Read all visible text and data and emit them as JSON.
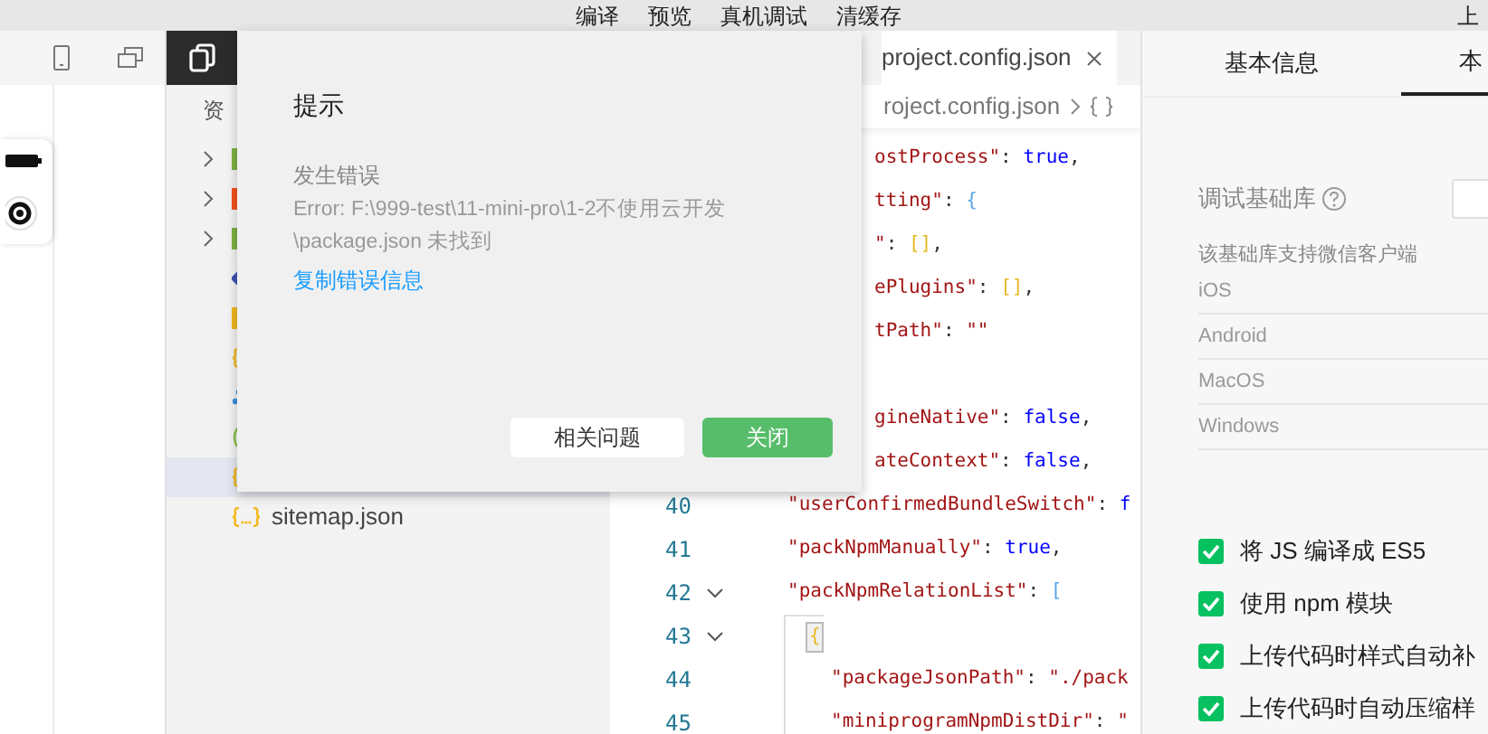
{
  "menu_bar": {
    "items": [
      "编译",
      "预览",
      "真机调试",
      "清缓存"
    ],
    "right_item": "上"
  },
  "explorer": {
    "title": "资",
    "items": [
      {
        "kind": "folder",
        "color": "#7cb342",
        "has_children": true,
        "selected": false
      },
      {
        "kind": "folder",
        "color": "#f4511e",
        "has_children": true,
        "selected": false
      },
      {
        "kind": "folder",
        "color": "#7cb342",
        "has_children": true,
        "selected": false
      },
      {
        "kind": "markup",
        "selected": false
      },
      {
        "kind": "style",
        "selected": false
      },
      {
        "kind": "json",
        "selected": false
      },
      {
        "kind": "script",
        "selected": false
      },
      {
        "kind": "config",
        "selected": false
      },
      {
        "kind": "json",
        "selected": true
      },
      {
        "kind": "json",
        "label": "sitemap.json",
        "selected": false
      }
    ]
  },
  "editor": {
    "tab": {
      "label": "project.config.json",
      "selected": true
    },
    "breadcrumb": "roject.config.json",
    "lines": [
      {
        "kind": "clipped",
        "tokens": [
          {
            "kind": "key",
            "text": "ostProcess\""
          },
          {
            "kind": "punct",
            "text": ": "
          },
          {
            "kind": "keyword",
            "text": "true"
          },
          {
            "kind": "punct",
            "text": ","
          }
        ]
      },
      {
        "kind": "clipped",
        "tokens": [
          {
            "kind": "key",
            "text": "tting\""
          },
          {
            "kind": "punct",
            "text": ": "
          },
          {
            "kind": "bracket",
            "text": "{"
          }
        ]
      },
      {
        "kind": "clipped",
        "tokens": [
          {
            "kind": "key",
            "text": "\""
          },
          {
            "kind": "punct",
            "text": ": "
          },
          {
            "kind": "bracket2",
            "text": "[]"
          },
          {
            "kind": "punct",
            "text": ","
          }
        ]
      },
      {
        "kind": "clipped",
        "tokens": [
          {
            "kind": "key",
            "text": "ePlugins\""
          },
          {
            "kind": "punct",
            "text": ": "
          },
          {
            "kind": "bracket2",
            "text": "[]"
          },
          {
            "kind": "punct",
            "text": ","
          }
        ]
      },
      {
        "kind": "clipped",
        "tokens": [
          {
            "kind": "key",
            "text": "tPath\""
          },
          {
            "kind": "punct",
            "text": ": "
          },
          {
            "kind": "key",
            "text": "\"\""
          }
        ]
      },
      {
        "kind": "clipped"
      },
      {
        "kind": "clipped",
        "tokens": [
          {
            "kind": "key",
            "text": "gineNative\""
          },
          {
            "kind": "punct",
            "text": ": "
          },
          {
            "kind": "keyword",
            "text": "false"
          },
          {
            "kind": "punct",
            "text": ","
          }
        ]
      },
      {
        "kind": "clipped",
        "tokens": [
          {
            "kind": "key",
            "text": "ateContext\""
          },
          {
            "kind": "punct",
            "text": ": "
          },
          {
            "kind": "keyword",
            "text": "false"
          },
          {
            "kind": "punct",
            "text": ","
          }
        ]
      },
      {
        "kind": "plain",
        "number": "40",
        "tokens": [
          {
            "kind": "key",
            "text": "\"userConfirmedBundleSwitch\""
          },
          {
            "kind": "punct",
            "text": ": "
          },
          {
            "kind": "keyword",
            "text": "f"
          }
        ]
      },
      {
        "kind": "plain",
        "number": "41",
        "tokens": [
          {
            "kind": "key",
            "text": "\"packNpmManually\""
          },
          {
            "kind": "punct",
            "text": ": "
          },
          {
            "kind": "keyword",
            "text": "true"
          },
          {
            "kind": "punct",
            "text": ","
          }
        ]
      },
      {
        "kind": "plain",
        "number": "42",
        "foldable": true,
        "tokens": [
          {
            "kind": "key",
            "text": "\"packNpmRelationList\""
          },
          {
            "kind": "punct",
            "text": ": "
          },
          {
            "kind": "bracket",
            "text": "["
          }
        ]
      },
      {
        "kind": "brace",
        "number": "43",
        "foldable": true,
        "tokens": [
          {
            "kind": "bracket2",
            "text": "{"
          }
        ]
      },
      {
        "kind": "nested",
        "number": "44",
        "tokens": [
          {
            "kind": "key",
            "text": "\"packageJsonPath\""
          },
          {
            "kind": "punct",
            "text": ": "
          },
          {
            "kind": "key",
            "text": "\"./pack"
          }
        ]
      },
      {
        "kind": "nested",
        "number": "45",
        "tokens": [
          {
            "kind": "key",
            "text": "\"miniprogramNpmDistDir\""
          },
          {
            "kind": "punct",
            "text": ": "
          },
          {
            "kind": "key",
            "text": "\""
          }
        ]
      }
    ]
  },
  "details": {
    "tabs": [
      {
        "label": "基本信息",
        "selected": false
      },
      {
        "label": "本",
        "selected": true
      }
    ],
    "library_label": "调试基础库",
    "support_title": "该基础库支持微信客户端",
    "clients": [
      "iOS",
      "Android",
      "MacOS",
      "Windows"
    ],
    "options": [
      {
        "label": "将 JS 编译成 ES5",
        "checked": true
      },
      {
        "label": "使用 npm 模块",
        "checked": true
      },
      {
        "label": "上传代码时样式自动补",
        "checked": true
      },
      {
        "label": "上传代码时自动压缩样",
        "checked": true
      }
    ]
  },
  "dialog": {
    "title": "提示",
    "heading": "发生错误",
    "message": [
      "Error: F:\\999-test\\11-mini-pro\\1-2不使用云开发",
      "\\package.json 未找到"
    ],
    "link": "复制错误信息",
    "buttons": [
      {
        "kind": "secondary",
        "label": "相关问题"
      },
      {
        "kind": "primary",
        "label": "关闭"
      }
    ]
  }
}
